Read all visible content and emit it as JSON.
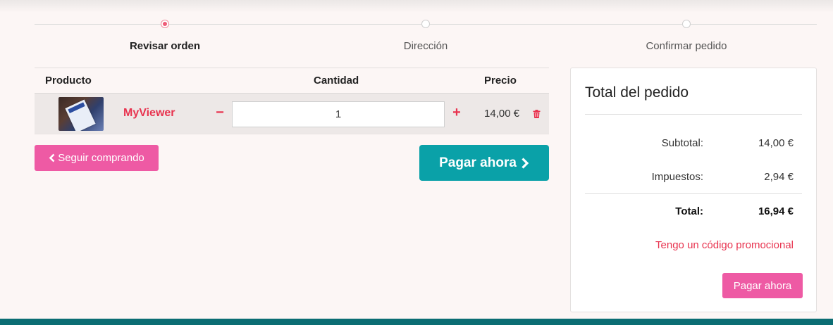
{
  "checkout_steps": [
    {
      "label": "Revisar orden",
      "state": "active"
    },
    {
      "label": "Dirección",
      "state": "pending"
    },
    {
      "label": "Confirmar pedido",
      "state": "pending"
    }
  ],
  "cart": {
    "headers": {
      "product": "Producto",
      "quantity": "Cantidad",
      "price": "Precio"
    },
    "items": [
      {
        "name": "MyViewer",
        "quantity": "1",
        "price": "14,00 €"
      }
    ],
    "icons": {
      "decrease": "minus-icon",
      "increase": "plus-icon",
      "remove": "trash-icon",
      "back": "chevron-left-icon",
      "forward": "chevron-right-icon"
    },
    "minus_glyph": "−",
    "plus_glyph": "+",
    "continue_label": "Seguir comprando",
    "pay_label": "Pagar ahora"
  },
  "summary": {
    "title": "Total del pedido",
    "subtotal_label": "Subtotal:",
    "subtotal_value": "14,00 €",
    "tax_label": "Impuestos:",
    "tax_value": "2,94 €",
    "total_label": "Total:",
    "total_value": "16,94 €",
    "promo_link": "Tengo un código promocional",
    "pay_label": "Pagar ahora"
  },
  "colors": {
    "accent_pink": "#ee5aa4",
    "accent_red": "#e8334f",
    "teal": "#0aa1a8",
    "footer": "#0b6d73"
  }
}
